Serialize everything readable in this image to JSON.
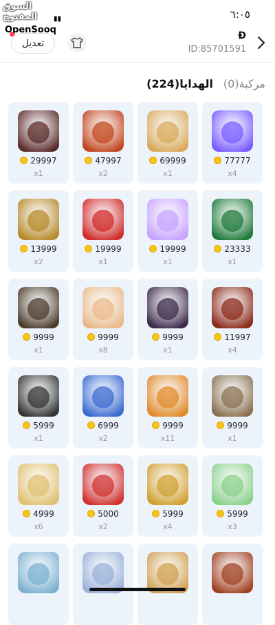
{
  "status": {
    "time": "٦:٠٥"
  },
  "watermark": {
    "arabic": "السوق المفتوح",
    "english": "OpenSooq"
  },
  "header": {
    "edit_label": "تعديل",
    "user_name": "Ɖ",
    "user_id": "ID:85701591"
  },
  "tabs": {
    "gifts": "الهدايا(224)",
    "cars": "مركبة(0)"
  },
  "gifts": [
    {
      "price": "77777",
      "count": "x4",
      "icon": "rocket-icon",
      "color": "#7a5cff"
    },
    {
      "price": "69999",
      "count": "x1",
      "icon": "lion-icon",
      "color": "#d8a95a"
    },
    {
      "price": "47997",
      "count": "x2",
      "icon": "eagle-icon",
      "color": "#c2451e"
    },
    {
      "price": "29997",
      "count": "x1",
      "icon": "emblem-icon",
      "color": "#5b2a2a"
    },
    {
      "price": "23333",
      "count": "x1",
      "icon": "saudi-flag-icon",
      "color": "#1f7a3a"
    },
    {
      "price": "19999",
      "count": "x1",
      "icon": "ferris-wheel-icon",
      "color": "#c7a2ff"
    },
    {
      "price": "19999",
      "count": "x1",
      "icon": "cobra-car-icon",
      "color": "#d02a2a"
    },
    {
      "price": "13999",
      "count": "x2",
      "icon": "gold-car-icon",
      "color": "#b58a2a"
    },
    {
      "price": "11997",
      "count": "x4",
      "icon": "fire-emblem-icon",
      "color": "#8a2a1a"
    },
    {
      "price": "9999",
      "count": "x1",
      "icon": "stage-icon",
      "color": "#3a2a4a"
    },
    {
      "price": "9999",
      "count": "x8",
      "icon": "quran-icon",
      "color": "#e9b98a"
    },
    {
      "price": "9999",
      "count": "x1",
      "icon": "lion-portrait-icon",
      "color": "#4a3a2a"
    },
    {
      "price": "9999",
      "count": "x1",
      "icon": "armored-lion-icon",
      "color": "#8a7050"
    },
    {
      "price": "9999",
      "count": "x11",
      "icon": "lion-head-icon",
      "color": "#e08a2a"
    },
    {
      "price": "6999",
      "count": "x2",
      "icon": "palace-icon",
      "color": "#3a6ad0"
    },
    {
      "price": "5999",
      "count": "x1",
      "icon": "suit-icon",
      "color": "#333333"
    },
    {
      "price": "5999",
      "count": "x3",
      "icon": "bottle-icon",
      "color": "#8ad08a"
    },
    {
      "price": "5999",
      "count": "x4",
      "icon": "lion-knight-icon",
      "color": "#d0a030"
    },
    {
      "price": "5000",
      "count": "x2",
      "icon": "boxing-gloves-icon",
      "color": "#d03030"
    },
    {
      "price": "4999",
      "count": "x6",
      "icon": "golden-eagle-icon",
      "color": "#e0c070"
    },
    {
      "price": "",
      "count": "",
      "icon": "lion-sale-icon",
      "color": "#a04020"
    },
    {
      "price": "",
      "count": "",
      "icon": "dagger-icon",
      "color": "#d0a050"
    },
    {
      "price": "",
      "count": "",
      "icon": "city-icon",
      "color": "#9ab0d8"
    },
    {
      "price": "",
      "count": "",
      "icon": "mosque-icon",
      "color": "#7ab0d0"
    }
  ]
}
